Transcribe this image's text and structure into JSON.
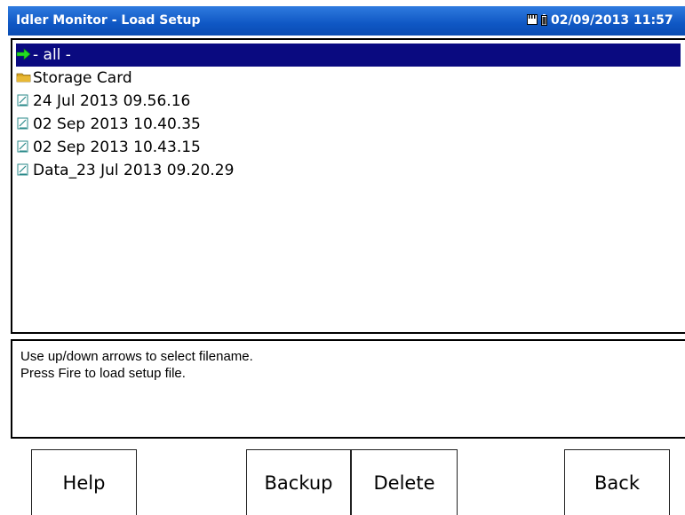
{
  "window": {
    "title": "Idler Monitor - Load Setup",
    "status_datetime": "02/09/2013 11:57"
  },
  "file_list": {
    "items": [
      {
        "label": "- all -",
        "icon": "green-arrow-icon",
        "selected": true
      },
      {
        "label": "Storage Card",
        "icon": "folder-icon",
        "selected": false
      },
      {
        "label": "24 Jul 2013 09.56.16",
        "icon": "file-icon",
        "selected": false
      },
      {
        "label": "02 Sep 2013 10.40.35",
        "icon": "file-icon",
        "selected": false
      },
      {
        "label": "02 Sep 2013 10.43.15",
        "icon": "file-icon",
        "selected": false
      },
      {
        "label": "Data_23 Jul 2013 09.20.29",
        "icon": "file-icon",
        "selected": false
      }
    ]
  },
  "hint": {
    "line1": "Use up/down arrows to select filename.",
    "line2": "Press Fire to load setup file."
  },
  "buttons": {
    "help": "Help",
    "backup": "Backup",
    "delete": "Delete",
    "back": "Back"
  },
  "colors": {
    "titlebar": "#0f57c4",
    "selection": "#0a0a80",
    "arrow": "#22dd22",
    "folder": "#d9a520"
  }
}
